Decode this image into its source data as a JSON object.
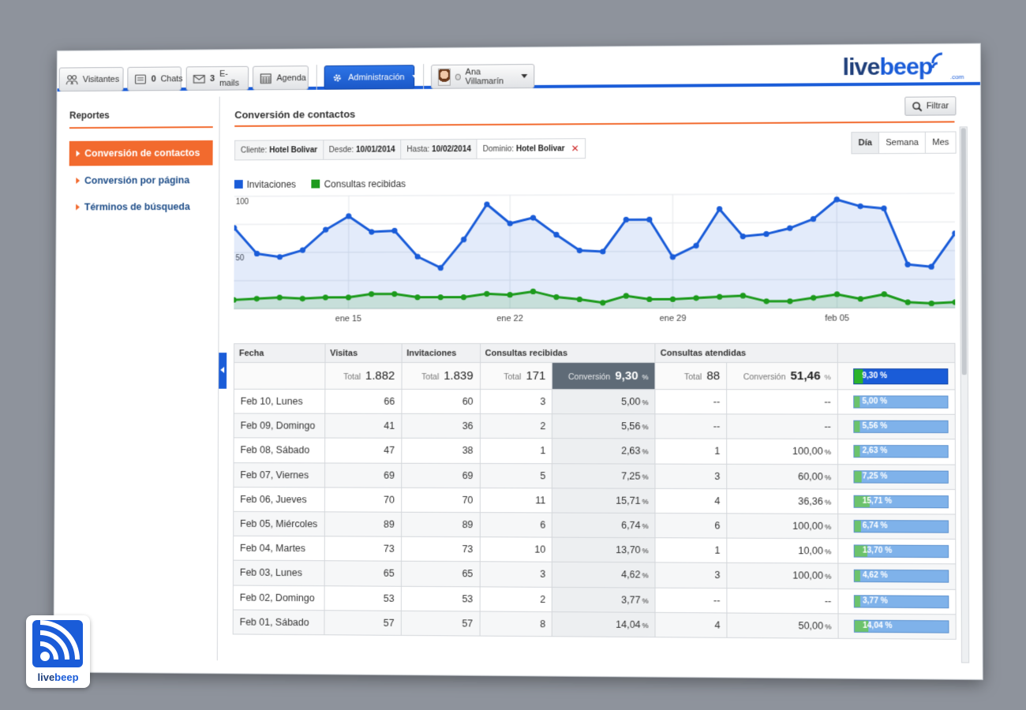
{
  "toolbar": {
    "visitantes": "Visitantes",
    "chats_count": "0",
    "chats": "Chats",
    "emails_count": "3",
    "emails": "E-mails",
    "agenda": "Agenda",
    "admin": "Administración",
    "user": "Ana Villamarín"
  },
  "logo": {
    "part1": "live",
    "part2": "beep",
    "com": ".com"
  },
  "sidebar": {
    "title": "Reportes",
    "items": [
      {
        "label": "Conversión de contactos",
        "active": true
      },
      {
        "label": "Conversión por página",
        "active": false
      },
      {
        "label": "Términos de búsqueda",
        "active": false
      }
    ]
  },
  "main": {
    "title": "Conversión de contactos",
    "filter_button": "Filtrar",
    "criteria": {
      "client_label": "Cliente:",
      "client": "Hotel Bolivar",
      "from_label": "Desde:",
      "from": "10/01/2014",
      "to_label": "Hasta:",
      "to": "10/02/2014",
      "domain_label": "Dominio:",
      "domain": "Hotel Bolivar",
      "remove": "✕"
    },
    "period": [
      "Día",
      "Semana",
      "Mes"
    ],
    "period_selected": "Día"
  },
  "chart_data": {
    "type": "area",
    "x_ticks": [
      "ene 15",
      "ene 22",
      "ene 29",
      "feb 05"
    ],
    "y_ticks": [
      100,
      50
    ],
    "ylim": [
      0,
      100
    ],
    "grid": true,
    "legend_position": "top-left",
    "series": [
      {
        "name": "Invitaciones",
        "color": "#1a5cd8",
        "values": [
          72,
          49,
          46,
          52,
          70,
          82,
          68,
          69,
          46,
          36,
          61,
          92,
          75,
          80,
          65,
          51,
          50,
          78,
          78,
          45,
          55,
          87,
          63,
          65,
          70,
          78,
          95,
          89,
          87,
          38,
          36,
          65
        ]
      },
      {
        "name": "Consultas recibidas",
        "color": "#1c9a1c",
        "values": [
          8,
          9,
          10,
          9,
          10,
          10,
          13,
          13,
          10,
          10,
          10,
          13,
          12,
          15,
          10,
          8,
          5,
          11,
          8,
          8,
          9,
          10,
          11,
          6,
          6,
          9,
          12,
          8,
          12,
          5,
          4,
          5
        ]
      }
    ]
  },
  "table": {
    "headers": {
      "fecha": "Fecha",
      "visitas": "Visitas",
      "invitaciones": "Invitaciones",
      "consultas_recibidas": "Consultas recibidas",
      "consultas_atendidas": "Consultas atendidas"
    },
    "totals": {
      "label": "Total",
      "conv_label": "Conversión",
      "visitas": "1.882",
      "invitaciones": "1.839",
      "recibidas": "171",
      "conv_recibidas": "9,30",
      "atendidas": "88",
      "conv_atendidas": "51,46",
      "pct": "%",
      "bar_label": "9,30 %",
      "bar_fraction": 0.093
    },
    "rows": [
      {
        "fecha": "Feb 10, Lunes",
        "visitas": "66",
        "invitaciones": "60",
        "recibidas": "3",
        "conv": "5,00",
        "atendidas": "--",
        "conv_at": "--",
        "bar_label": "5,00 %",
        "bar_fraction": 0.05
      },
      {
        "fecha": "Feb 09, Domingo",
        "visitas": "41",
        "invitaciones": "36",
        "recibidas": "2",
        "conv": "5,56",
        "atendidas": "--",
        "conv_at": "--",
        "bar_label": "5,56 %",
        "bar_fraction": 0.0556
      },
      {
        "fecha": "Feb 08, Sábado",
        "visitas": "47",
        "invitaciones": "38",
        "recibidas": "1",
        "conv": "2,63",
        "atendidas": "1",
        "conv_at": "100,00",
        "bar_label": "2,63 %",
        "bar_fraction": 0.0263
      },
      {
        "fecha": "Feb 07, Viernes",
        "visitas": "69",
        "invitaciones": "69",
        "recibidas": "5",
        "conv": "7,25",
        "atendidas": "3",
        "conv_at": "60,00",
        "bar_label": "7,25 %",
        "bar_fraction": 0.0725
      },
      {
        "fecha": "Feb 06, Jueves",
        "visitas": "70",
        "invitaciones": "70",
        "recibidas": "11",
        "conv": "15,71",
        "atendidas": "4",
        "conv_at": "36,36",
        "bar_label": "15,71 %",
        "bar_fraction": 0.1571
      },
      {
        "fecha": "Feb 05, Miércoles",
        "visitas": "89",
        "invitaciones": "89",
        "recibidas": "6",
        "conv": "6,74",
        "atendidas": "6",
        "conv_at": "100,00",
        "bar_label": "6,74 %",
        "bar_fraction": 0.0674
      },
      {
        "fecha": "Feb 04, Martes",
        "visitas": "73",
        "invitaciones": "73",
        "recibidas": "10",
        "conv": "13,70",
        "atendidas": "1",
        "conv_at": "10,00",
        "bar_label": "13,70 %",
        "bar_fraction": 0.137
      },
      {
        "fecha": "Feb 03, Lunes",
        "visitas": "65",
        "invitaciones": "65",
        "recibidas": "3",
        "conv": "4,62",
        "atendidas": "3",
        "conv_at": "100,00",
        "bar_label": "4,62 %",
        "bar_fraction": 0.0462
      },
      {
        "fecha": "Feb 02, Domingo",
        "visitas": "53",
        "invitaciones": "53",
        "recibidas": "2",
        "conv": "3,77",
        "atendidas": "--",
        "conv_at": "--",
        "bar_label": "3,77 %",
        "bar_fraction": 0.0377
      },
      {
        "fecha": "Feb 01, Sábado",
        "visitas": "57",
        "invitaciones": "57",
        "recibidas": "8",
        "conv": "14,04",
        "atendidas": "4",
        "conv_at": "50,00",
        "bar_label": "14,04 %",
        "bar_fraction": 0.1404
      }
    ]
  },
  "badge": {
    "part1": "live",
    "part2": "beep"
  },
  "colors": {
    "accent": "#f26a2e",
    "brand": "#1a5cd8",
    "green": "#1c9a1c"
  }
}
